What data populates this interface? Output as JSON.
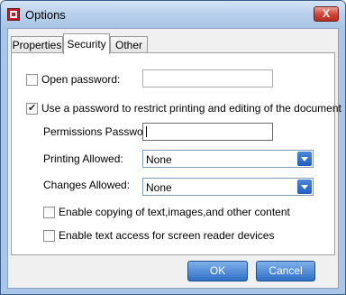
{
  "window": {
    "title": "Options",
    "close_label": "X"
  },
  "tabs": [
    {
      "label": "Properties",
      "active": false
    },
    {
      "label": "Security",
      "active": true
    },
    {
      "label": "Other",
      "active": false
    }
  ],
  "security": {
    "open_password": {
      "label": "Open password:",
      "checked": false,
      "value": ""
    },
    "restrict": {
      "label": "Use a password to restrict printing and editing of the document",
      "checked": true
    },
    "permissions_password": {
      "label": "Permissions Password:",
      "value": ""
    },
    "printing_allowed": {
      "label": "Printing Allowed:",
      "value": "None"
    },
    "changes_allowed": {
      "label": "Changes Allowed:",
      "value": "None"
    },
    "enable_copying": {
      "label": "Enable copying of text,images,and other content",
      "checked": false
    },
    "enable_screen_reader": {
      "label": "Enable text access for screen reader devices",
      "checked": false
    }
  },
  "buttons": {
    "ok": "OK",
    "cancel": "Cancel"
  },
  "colors": {
    "button_blue": "#2f6fc6",
    "title_bar": "#b7d0ec",
    "close_red": "#d2473a"
  }
}
